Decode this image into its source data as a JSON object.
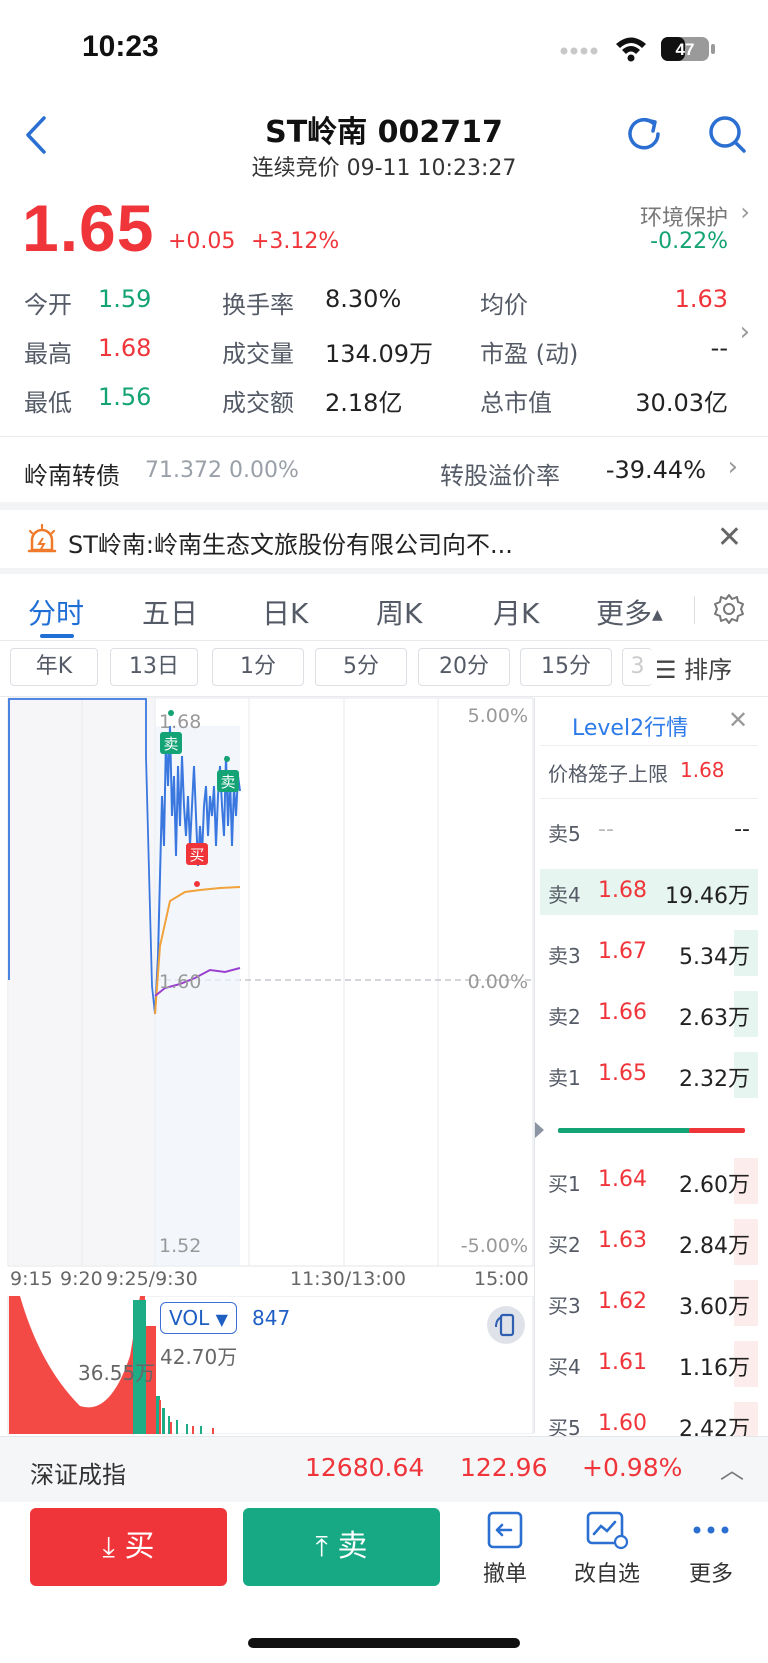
{
  "status_bar": {
    "time": "10:23",
    "battery": "47"
  },
  "header": {
    "title": "ST岭南 002717",
    "status": "连续竞价 09-11 10:23:27"
  },
  "quote": {
    "price": "1.65",
    "change": "+0.05",
    "change_pct": "+3.12%",
    "sector": "环境保护",
    "sector_change": "-0.22%",
    "stats": [
      {
        "label": "今开",
        "value": "1.59",
        "color": "#14a374"
      },
      {
        "label": "换手率",
        "value": "8.30%",
        "color": "#222222"
      },
      {
        "label": "均价",
        "value": "1.63",
        "color": "#f0353a"
      },
      {
        "label": "最高",
        "value": "1.68",
        "color": "#f0353a"
      },
      {
        "label": "成交量",
        "value": "134.09万",
        "color": "#222222"
      },
      {
        "label": "市盈 (动)",
        "value": "--",
        "color": "#222222"
      },
      {
        "label": "最低",
        "value": "1.56",
        "color": "#14a374"
      },
      {
        "label": "成交额",
        "value": "2.18亿",
        "color": "#222222"
      },
      {
        "label": "总市值",
        "value": "30.03亿",
        "color": "#222222"
      }
    ]
  },
  "bond": {
    "name": "岭南转债",
    "value": "71.372 0.00%",
    "premium_label": "转股溢价率",
    "premium_value": "-39.44%"
  },
  "notice": {
    "text": "ST岭南:岭南生态文旅股份有限公司向不..."
  },
  "tabs": [
    "分时",
    "五日",
    "日K",
    "周K",
    "月K",
    "更多"
  ],
  "period_chips": [
    "年K",
    "13日",
    "1分",
    "5分",
    "20分",
    "15分",
    "3"
  ],
  "sort_label": "排序",
  "chart": {
    "price_high": "1.68",
    "price_mid": "1.60",
    "price_low": "1.52",
    "pct_high": "5.00%",
    "pct_mid": "0.00%",
    "pct_low": "-5.00%",
    "sell_marker": "卖",
    "buy_marker": "买",
    "time_labels": [
      "9:15",
      "9:20",
      "9:25/9:30",
      "11:30/13:00",
      "15:00"
    ]
  },
  "volume": {
    "indicator": "VOL",
    "value": "847",
    "max": "42.70万",
    "left_label": "36.55万"
  },
  "level2": {
    "title": "Level2行情",
    "limit_label": "价格笼子上限",
    "limit_value": "1.68",
    "asks": [
      {
        "label": "卖5",
        "price": "--",
        "volume": "--",
        "bar": 0
      },
      {
        "label": "卖4",
        "price": "1.68",
        "volume": "19.46万",
        "bar": 1.0
      },
      {
        "label": "卖3",
        "price": "1.67",
        "volume": "5.34万",
        "bar": 0.27
      },
      {
        "label": "卖2",
        "price": "1.66",
        "volume": "2.63万",
        "bar": 0.14
      },
      {
        "label": "卖1",
        "price": "1.65",
        "volume": "2.32万",
        "bar": 0.12
      }
    ],
    "bids": [
      {
        "label": "买1",
        "price": "1.64",
        "volume": "2.60万",
        "bar": 0.13
      },
      {
        "label": "买2",
        "price": "1.63",
        "volume": "2.84万",
        "bar": 0.15
      },
      {
        "label": "买3",
        "price": "1.62",
        "volume": "3.60万",
        "bar": 0.18
      },
      {
        "label": "买4",
        "price": "1.61",
        "volume": "1.16万",
        "bar": 0.06
      },
      {
        "label": "买5",
        "price": "1.60",
        "volume": "2.42万",
        "bar": 0.12
      }
    ]
  },
  "index": {
    "name": "深证成指",
    "value": "12680.64",
    "change": "122.96",
    "change_pct": "+0.98%"
  },
  "actions": {
    "buy": "买",
    "sell": "卖",
    "cancel": "撤单",
    "watchlist": "改自选",
    "more": "更多"
  }
}
